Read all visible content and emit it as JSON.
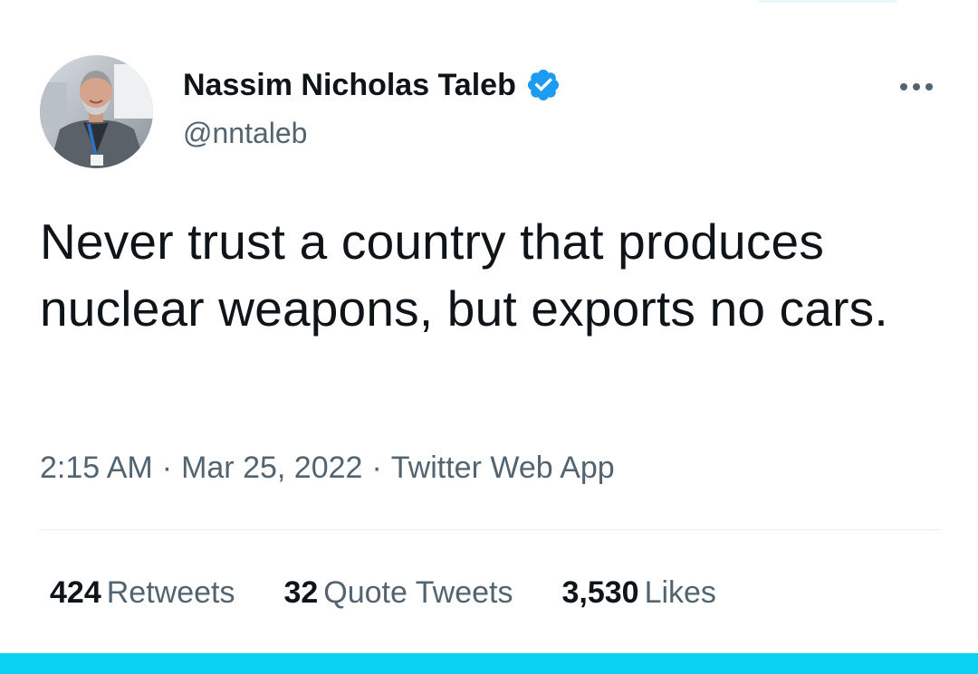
{
  "tweet": {
    "author": {
      "name": "Nassim Nicholas Taleb",
      "handle": "@nntaleb",
      "verified": true,
      "avatar_icon": "user-avatar-photo",
      "verified_icon": "verified-badge-icon"
    },
    "more_icon": "more-options-icon",
    "text": "Never trust a country that produces nuclear weapons, but exports no cars.",
    "meta": {
      "time": "2:15 AM",
      "separator": "·",
      "date": "Mar 25, 2022",
      "source": "Twitter Web App"
    },
    "stats": {
      "retweets_count": "424",
      "retweets_label": "Retweets",
      "quotes_count": "32",
      "quotes_label": "Quote Tweets",
      "likes_count": "3,530",
      "likes_label": "Likes"
    }
  },
  "colors": {
    "text_primary": "#0f1419",
    "text_secondary": "#536471",
    "verified_blue": "#1d9bf0",
    "divider": "#e6ecf0",
    "bottom_bar": "#0bd1f2"
  }
}
